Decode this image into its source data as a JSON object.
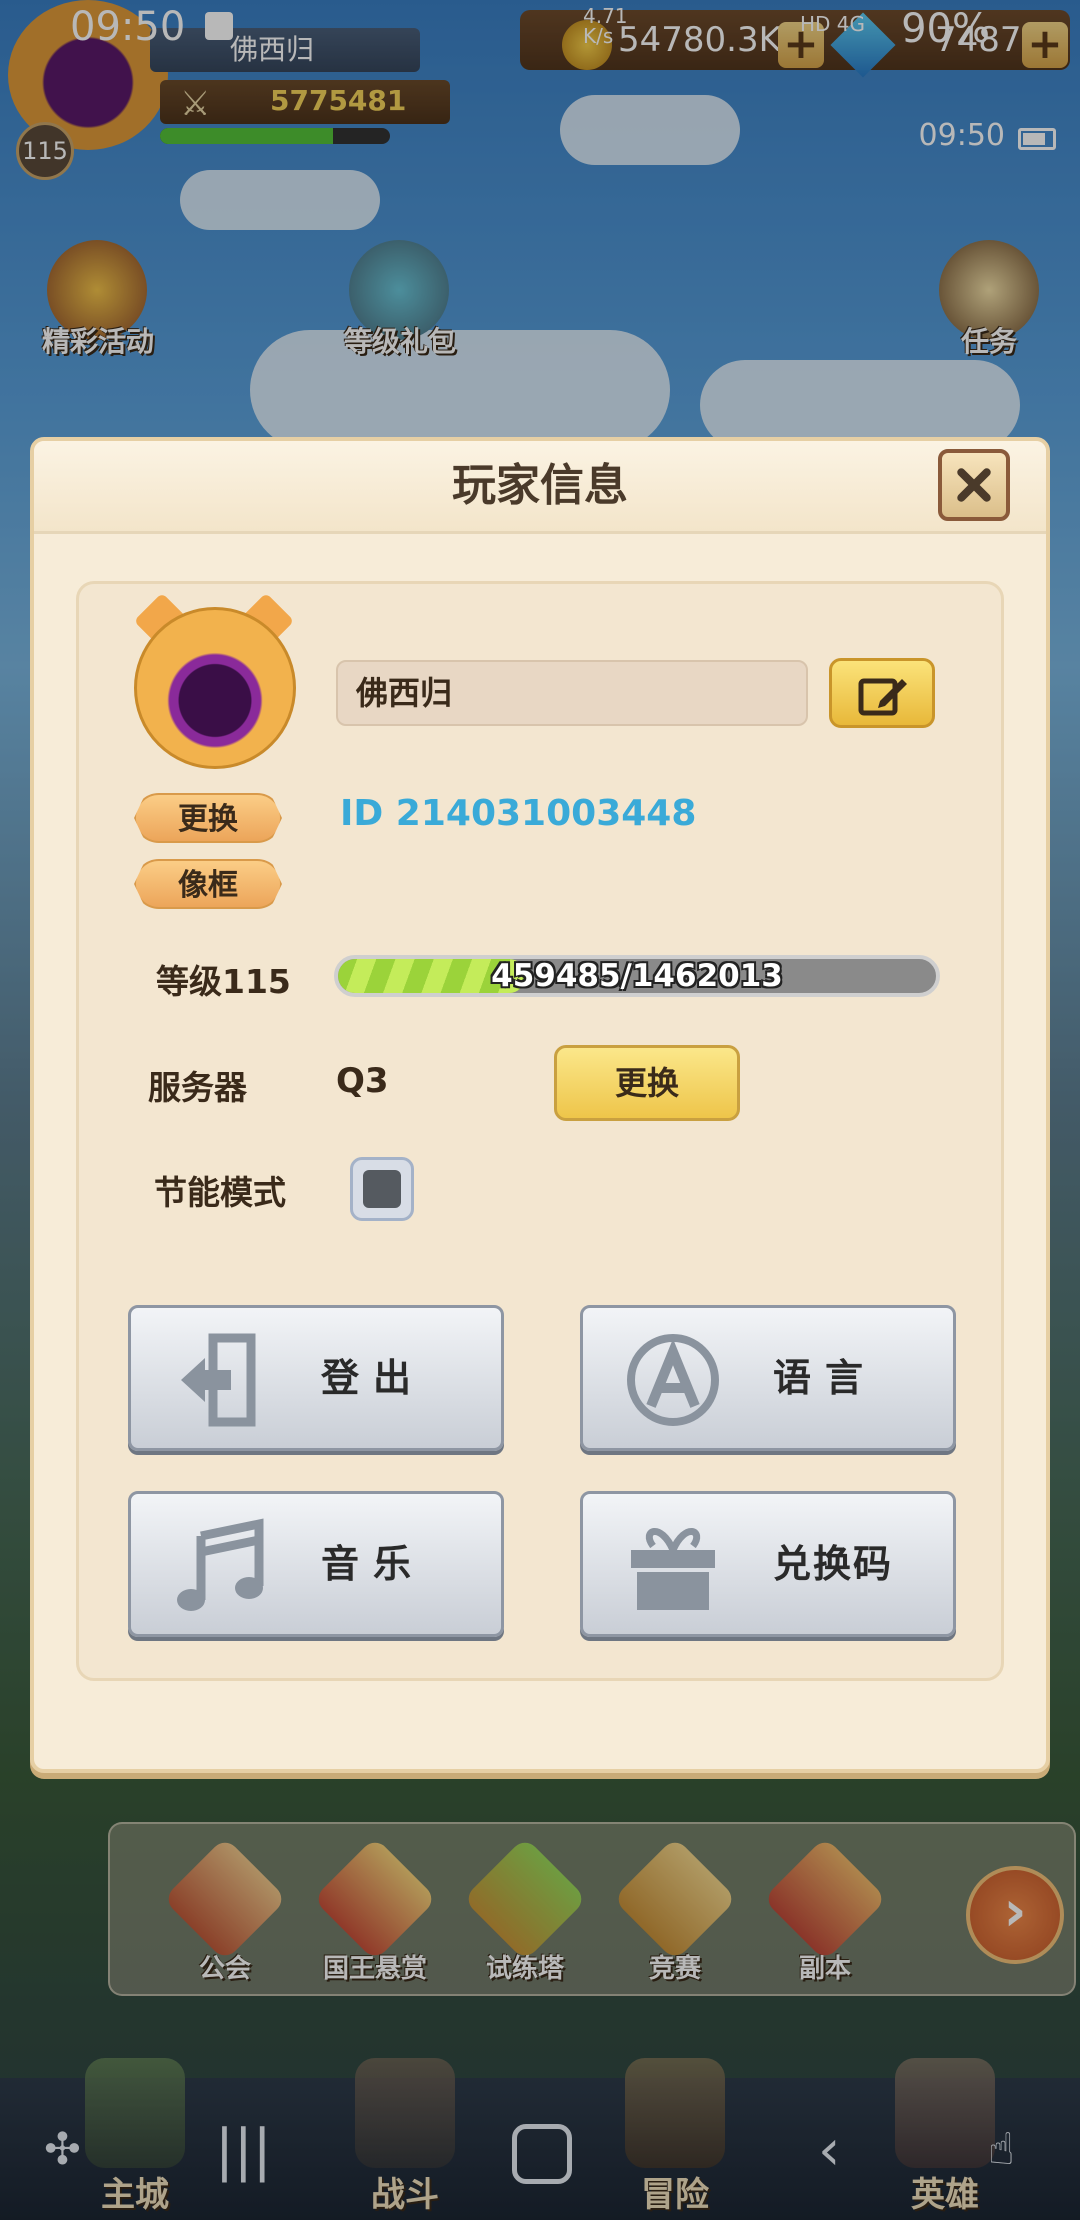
{
  "status_bar": {
    "time": "09:50",
    "net_speed": "4.71\nK/s",
    "network": "HD 4G",
    "battery": "90%"
  },
  "player_hud": {
    "name": "佛西归",
    "power": "5775481",
    "level": "115",
    "exp_fraction": 0.75,
    "gold": "54780.3K",
    "gems": "7487",
    "clock": "09:50"
  },
  "events": [
    {
      "label": "精彩活动",
      "icon": "treasure-chest-icon"
    },
    {
      "label": "等级礼包",
      "icon": "gift-box-icon"
    },
    {
      "label": "任务",
      "icon": "scroll-icon"
    }
  ],
  "modal": {
    "title": "玩家信息",
    "player_name": "佛西归",
    "player_id": "ID 214031003448",
    "change_label": "更换",
    "frame_label": "像框",
    "level_label": "等级115",
    "exp_text": "459485/1462013",
    "exp_progress": 0.314,
    "server_label": "服务器",
    "server_value": "Q3",
    "server_change_label": "更换",
    "energy_saving_label": "节能模式",
    "energy_saving_checked": false,
    "buttons": {
      "logout": "登出",
      "language": "语言",
      "music": "音乐",
      "redeem": "兑换码"
    }
  },
  "features": [
    {
      "label": "公会",
      "icon": "guild-shield-icon",
      "color": "#d05a4a"
    },
    {
      "label": "国王悬赏",
      "icon": "crown-icon",
      "color": "#d06a4a"
    },
    {
      "label": "试练塔",
      "icon": "green-gem-icon",
      "color": "#d8a24a"
    },
    {
      "label": "竞赛",
      "icon": "crossed-swords-icon",
      "color": "#d8b05a"
    },
    {
      "label": "副本",
      "icon": "treasure-pot-icon",
      "color": "#c85a4a"
    }
  ],
  "nav": [
    {
      "label": "主城",
      "icon": "castle-icon"
    },
    {
      "label": "战斗",
      "icon": "swords-icon"
    },
    {
      "label": "冒险",
      "icon": "adventure-icon"
    },
    {
      "label": "英雄",
      "icon": "hero-icon"
    }
  ]
}
